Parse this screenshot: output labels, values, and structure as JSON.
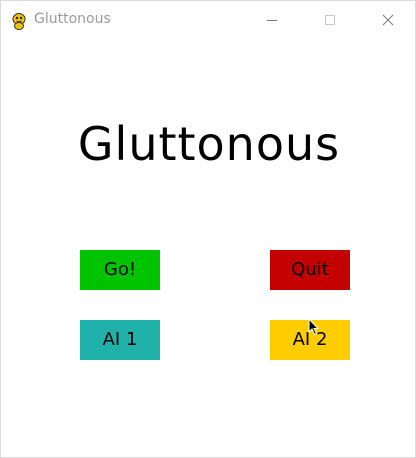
{
  "window": {
    "title": "Gluttonous",
    "app_icon": "pygame-snake-icon",
    "controls": [
      "minimize-icon",
      "maximize-icon",
      "close-icon"
    ]
  },
  "game": {
    "title": "Gluttonous",
    "buttons": [
      {
        "label": "Go!",
        "color": "#00c300"
      },
      {
        "label": "Quit",
        "color": "#c40000"
      },
      {
        "label": "AI 1",
        "color": "#20b2aa"
      },
      {
        "label": "AI 2",
        "color": "#ffcc00"
      }
    ]
  },
  "colors": {
    "background": "#ffffff",
    "title_text": "#000000",
    "titlebar_text": "#9a9a9a"
  }
}
